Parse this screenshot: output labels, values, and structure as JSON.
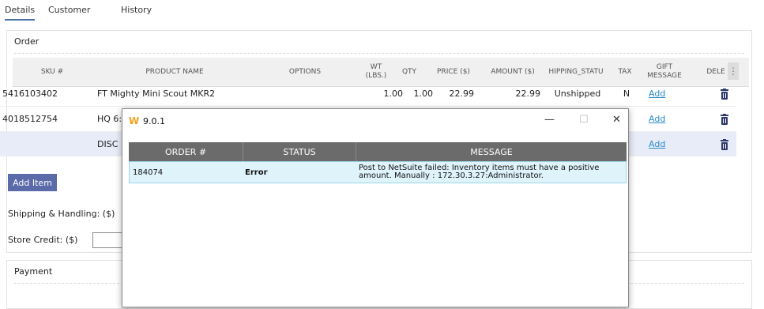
{
  "tabs": [
    {
      "label": "Details",
      "active": true
    },
    {
      "label": "Customer",
      "active": false
    },
    {
      "label": "History",
      "active": false
    }
  ],
  "order_panel": {
    "title": "Order"
  },
  "grid": {
    "columns": [
      "SKU #",
      "PRODUCT NAME",
      "OPTIONS",
      "WT (LBS.)",
      "QTY",
      "PRICE ($)",
      "AMOUNT ($)",
      "HIPPING_STATU",
      "TAX",
      "GIFT MESSAGE",
      "DELE"
    ],
    "rows": [
      {
        "sku": "5416103402",
        "product": "FT Mighty Mini Scout MKR2",
        "options": "",
        "wt": "1.00",
        "qty": "1.00",
        "price": "22.99",
        "amount": "22.99",
        "shipping": "Unshipped",
        "tax": "N",
        "gift": "Add"
      },
      {
        "sku": "4018512754",
        "product": "HQ 6:",
        "options": "",
        "wt": "",
        "qty": "",
        "price": "",
        "amount": "",
        "shipping": "",
        "tax": "",
        "gift": "Add"
      },
      {
        "sku": "",
        "product": "DISC",
        "options": "",
        "wt": "",
        "qty": "",
        "price": "",
        "amount": "",
        "shipping": "",
        "tax": "",
        "gift": "Add"
      }
    ]
  },
  "buttons": {
    "add_item": "Add Item"
  },
  "labels": {
    "shipping": "Shipping & Handling: ($)",
    "store_credit": "Store Credit: ($)"
  },
  "payment_panel": {
    "title": "Payment"
  },
  "modal": {
    "title": "9.0.1",
    "controls": {
      "minimize": "—",
      "maximize": "☐",
      "close": "✕"
    },
    "columns": [
      "ORDER #",
      "STATUS",
      "MESSAGE"
    ],
    "rows": [
      {
        "order": "184074",
        "status": "Error",
        "message_line1": "Post to NetSuite failed: Inventory items must have a positive",
        "message_line2": "amount.   Manually : 172.30.3.27:Administrator."
      }
    ]
  },
  "colors": {
    "accent": "#5b6aa8",
    "link": "#2a8ac8",
    "modal_header": "#6b6b6b",
    "row_highlight": "#dff3fb",
    "trash": "#2d3a6b"
  }
}
